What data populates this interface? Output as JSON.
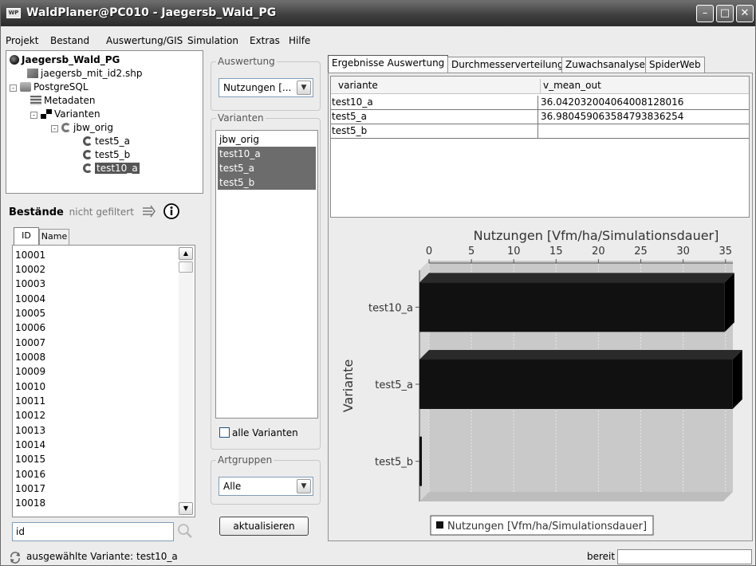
{
  "window": {
    "title": "WaldPlaner@PC010 - Jaegersb_Wald_PG",
    "app_icon_text": "WP",
    "controls": {
      "minimize": "–",
      "maximize": "□",
      "close": "✕"
    }
  },
  "menubar": [
    "Projekt",
    "Bestand",
    "Auswertung/GIS",
    "Simulation",
    "Extras",
    "Hilfe"
  ],
  "tree": {
    "root": "Jaegersb_Wald_PG",
    "shapefile": "jaegersb_mit_id2.shp",
    "database": "PostgreSQL",
    "metadata": "Metadaten",
    "variants": "Varianten",
    "base_variant": "jbw_orig",
    "children": [
      "test5_a",
      "test5_b",
      "test10_a"
    ],
    "selected": "test10_a"
  },
  "bestaende": {
    "title": "Bestände",
    "filter_status": "nicht gefiltert",
    "tabs": [
      "ID",
      "Name"
    ],
    "ids": [
      "10001",
      "10002",
      "10003",
      "10004",
      "10005",
      "10006",
      "10007",
      "10008",
      "10009",
      "10010",
      "10011",
      "10012",
      "10013",
      "10014",
      "10015",
      "10016",
      "10017",
      "10018"
    ],
    "search_value": "id"
  },
  "auswertung": {
    "group_label": "Auswertung",
    "selected": "Nutzungen [..."
  },
  "varianten": {
    "group_label": "Varianten",
    "items": [
      {
        "label": "jbw_orig",
        "selected": false
      },
      {
        "label": "test10_a",
        "selected": true
      },
      {
        "label": "test5_a",
        "selected": true
      },
      {
        "label": "test5_b",
        "selected": true
      }
    ],
    "all_checkbox": "alle Varianten",
    "all_checked": false
  },
  "artgruppen": {
    "group_label": "Artgruppen",
    "selected": "Alle"
  },
  "refresh_button": "aktualisieren",
  "result_tabs": [
    "Ergebnisse Auswertung",
    "Durchmesserverteilung",
    "Zuwachsanalyse",
    "SpiderWeb"
  ],
  "result_table": {
    "columns": [
      "variante",
      "v_mean_out"
    ],
    "rows": [
      [
        "test10_a",
        "36.04203200406400812801​6"
      ],
      [
        "test5_a",
        "36.98045906358479383625​4"
      ],
      [
        "test5_b",
        ""
      ]
    ]
  },
  "chart_data": {
    "type": "bar",
    "orientation": "horizontal",
    "title": "Nutzungen [Vfm/ha/Simulationsdauer]",
    "ylabel": "Variante",
    "xlabel": "",
    "categories": [
      "test10_a",
      "test5_a",
      "test5_b"
    ],
    "series": [
      {
        "name": "Nutzungen [Vfm/ha/Simulationsdauer]",
        "values": [
          36.042,
          36.98,
          0
        ]
      }
    ],
    "xlim": [
      0,
      37
    ],
    "x_ticks": [
      "0",
      "5",
      "10",
      "15",
      "20",
      "25",
      "30",
      "35"
    ],
    "x_axis_position": "top",
    "legend_position": "bottom",
    "bar_color": "#111111",
    "plot_background": "#c9c9c9",
    "grid": true
  },
  "statusbar": {
    "message": "ausgewählte Variante: test10_a",
    "state": "bereit"
  }
}
